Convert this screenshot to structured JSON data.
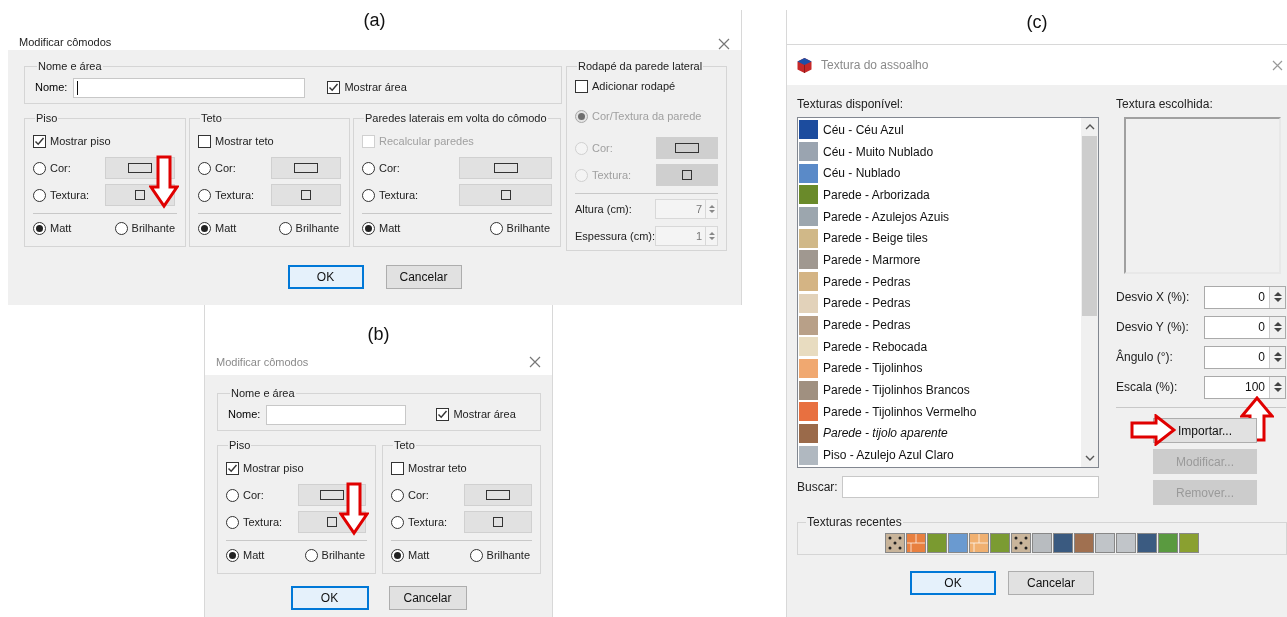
{
  "panels": [
    {
      "caption": "(a)",
      "dialog": {
        "title": "Modificar cômodos",
        "active": true,
        "name_area": {
          "legend": "Nome e área",
          "name_label": "Nome:",
          "cursor": true,
          "show_area": {
            "label": "Mostrar área",
            "checked": true
          }
        },
        "groups": [
          {
            "legend": "Piso",
            "toggle": {
              "label": "Mostrar piso",
              "checked": true,
              "disabled": false
            },
            "fill": [
              {
                "label": "Cor:",
                "kind": "color",
                "selected": false,
                "disabled": false
              },
              {
                "label": "Textura:",
                "kind": "texture",
                "selected": false,
                "disabled": false
              }
            ],
            "finish": [
              {
                "label": "Matt",
                "selected": true
              },
              {
                "label": "Brilhante",
                "selected": false
              }
            ],
            "arrow": true
          },
          {
            "legend": "Teto",
            "toggle": {
              "label": "Mostrar teto",
              "checked": false,
              "disabled": false
            },
            "fill": [
              {
                "label": "Cor:",
                "kind": "color",
                "selected": false,
                "disabled": false
              },
              {
                "label": "Textura:",
                "kind": "texture",
                "selected": false,
                "disabled": false
              }
            ],
            "finish": [
              {
                "label": "Matt",
                "selected": true
              },
              {
                "label": "Brilhante",
                "selected": false
              }
            ],
            "arrow": false
          },
          {
            "legend": "Paredes laterais em volta do cômodo",
            "toggle": {
              "label": "Recalcular paredes",
              "checked": false,
              "disabled": true
            },
            "fill": [
              {
                "label": "Cor:",
                "kind": "color",
                "selected": false,
                "disabled": false
              },
              {
                "label": "Textura:",
                "kind": "texture",
                "selected": false,
                "disabled": false
              }
            ],
            "finish": [
              {
                "label": "Matt",
                "selected": true
              },
              {
                "label": "Brilhante",
                "selected": false
              }
            ],
            "arrow": false
          }
        ],
        "baseboard": {
          "legend": "Rodapé da parede lateral",
          "toggle": {
            "label": "Adicionar rodapé",
            "checked": false,
            "disabled": false
          },
          "fill": [
            {
              "label": "Cor/Textura da parede",
              "kind": "wall",
              "selected": true,
              "disabled": true
            },
            {
              "label": "Cor:",
              "kind": "color",
              "selected": false,
              "disabled": true
            },
            {
              "label": "Textura:",
              "kind": "texture",
              "selected": false,
              "disabled": true
            }
          ],
          "sizes": [
            {
              "label": "Altura (cm):",
              "value": "7",
              "disabled": true
            },
            {
              "label": "Espessura (cm):",
              "value": "1",
              "disabled": true
            }
          ]
        },
        "buttons": [
          {
            "label": "OK",
            "default": true
          },
          {
            "label": "Cancelar",
            "default": false
          }
        ]
      }
    },
    {
      "caption": "(b)",
      "dialog": {
        "title": "Modificar cômodos",
        "active": false,
        "name_area": {
          "legend": "Nome e área",
          "name_label": "Nome:",
          "cursor": false,
          "show_area": {
            "label": "Mostrar área",
            "checked": true
          }
        },
        "groups": [
          {
            "legend": "Piso",
            "toggle": {
              "label": "Mostrar piso",
              "checked": true,
              "disabled": false
            },
            "fill": [
              {
                "label": "Cor:",
                "kind": "color",
                "selected": false,
                "disabled": false
              },
              {
                "label": "Textura:",
                "kind": "texture",
                "selected": false,
                "disabled": false
              }
            ],
            "finish": [
              {
                "label": "Matt",
                "selected": true
              },
              {
                "label": "Brilhante",
                "selected": false
              }
            ],
            "arrow": true
          },
          {
            "legend": "Teto",
            "toggle": {
              "label": "Mostrar teto",
              "checked": false,
              "disabled": false
            },
            "fill": [
              {
                "label": "Cor:",
                "kind": "color",
                "selected": false,
                "disabled": false
              },
              {
                "label": "Textura:",
                "kind": "texture",
                "selected": false,
                "disabled": false
              }
            ],
            "finish": [
              {
                "label": "Matt",
                "selected": true
              },
              {
                "label": "Brilhante",
                "selected": false
              }
            ],
            "arrow": false
          }
        ],
        "buttons": [
          {
            "label": "OK",
            "default": true
          },
          {
            "label": "Cancelar",
            "default": false
          }
        ]
      }
    },
    {
      "caption": "(c)",
      "texture_dialog": {
        "title": "Textura do assoalho",
        "active": false,
        "available_label": "Texturas disponível:",
        "textures": [
          {
            "name": "Céu - Céu Azul",
            "color": "#1c4c9e",
            "italic": false
          },
          {
            "name": "Céu - Muito Nublado",
            "color": "#9aa4b0",
            "italic": false
          },
          {
            "name": "Céu - Nublado",
            "color": "#5a8ac8",
            "italic": false
          },
          {
            "name": "Parede - Arborizada",
            "color": "#6a8a2a",
            "italic": false
          },
          {
            "name": "Parede - Azulejos Azuis",
            "color": "#9ca6ae",
            "italic": false
          },
          {
            "name": "Parede - Beige tiles",
            "color": "#d0b888",
            "italic": false
          },
          {
            "name": "Parede - Marmore",
            "color": "#a09890",
            "italic": false
          },
          {
            "name": "Parede - Pedras",
            "color": "#d4b484",
            "italic": false
          },
          {
            "name": "Parede - Pedras",
            "color": "#e2d2ba",
            "italic": false
          },
          {
            "name": "Parede - Pedras",
            "color": "#b8a088",
            "italic": false
          },
          {
            "name": "Parede - Rebocada",
            "color": "#e8dcc0",
            "italic": false
          },
          {
            "name": "Parede - Tijolinhos",
            "color": "#f0a870",
            "italic": false
          },
          {
            "name": "Parede - Tijolinhos Brancos",
            "color": "#a09080",
            "italic": false
          },
          {
            "name": "Parede - Tijolinhos Vermelho",
            "color": "#e87040",
            "italic": false
          },
          {
            "name": "Parede - tijolo aparente",
            "color": "#9a6a4a",
            "italic": true
          },
          {
            "name": "Piso - Azulejo Azul Claro",
            "color": "#b0b8c0",
            "italic": false
          }
        ],
        "search_label": "Buscar:",
        "chosen_label": "Textura escolhida:",
        "adjustments": [
          {
            "label": "Desvio X (%):",
            "value": "0",
            "arrow": false
          },
          {
            "label": "Desvio Y (%):",
            "value": "0",
            "arrow": false
          },
          {
            "label": "Ângulo (°):",
            "value": "0",
            "arrow": false
          },
          {
            "label": "Escala (%):",
            "value": "100",
            "arrow": true
          }
        ],
        "actions": [
          {
            "label": "Importar...",
            "disabled": false,
            "arrow": true
          },
          {
            "label": "Modificar...",
            "disabled": true,
            "arrow": false
          },
          {
            "label": "Remover...",
            "disabled": true,
            "arrow": false
          }
        ],
        "recent_legend": "Texturas recentes",
        "recent": [
          {
            "kind": "dotted",
            "color": "#c8b49a"
          },
          {
            "kind": "brick",
            "color": "#e88040"
          },
          {
            "kind": "plain",
            "color": "#7a9a30"
          },
          {
            "kind": "plain",
            "color": "#6a9ad0"
          },
          {
            "kind": "brick",
            "color": "#f0b070"
          },
          {
            "kind": "plain",
            "color": "#7b9b32"
          },
          {
            "kind": "dotted",
            "color": "#c9b59b"
          },
          {
            "kind": "plain",
            "color": "#b8bcc0"
          },
          {
            "kind": "plain",
            "color": "#3a5a80"
          },
          {
            "kind": "plain",
            "color": "#a07050"
          },
          {
            "kind": "plain",
            "color": "#c0c4c8"
          },
          {
            "kind": "plain",
            "color": "#c1c5c9"
          },
          {
            "kind": "plain",
            "color": "#3b5b81"
          },
          {
            "kind": "plain",
            "color": "#5a9a40"
          },
          {
            "kind": "plain",
            "color": "#8aa030"
          }
        ],
        "buttons": [
          {
            "label": "OK",
            "default": true
          },
          {
            "label": "Cancelar",
            "default": false
          }
        ]
      }
    }
  ]
}
